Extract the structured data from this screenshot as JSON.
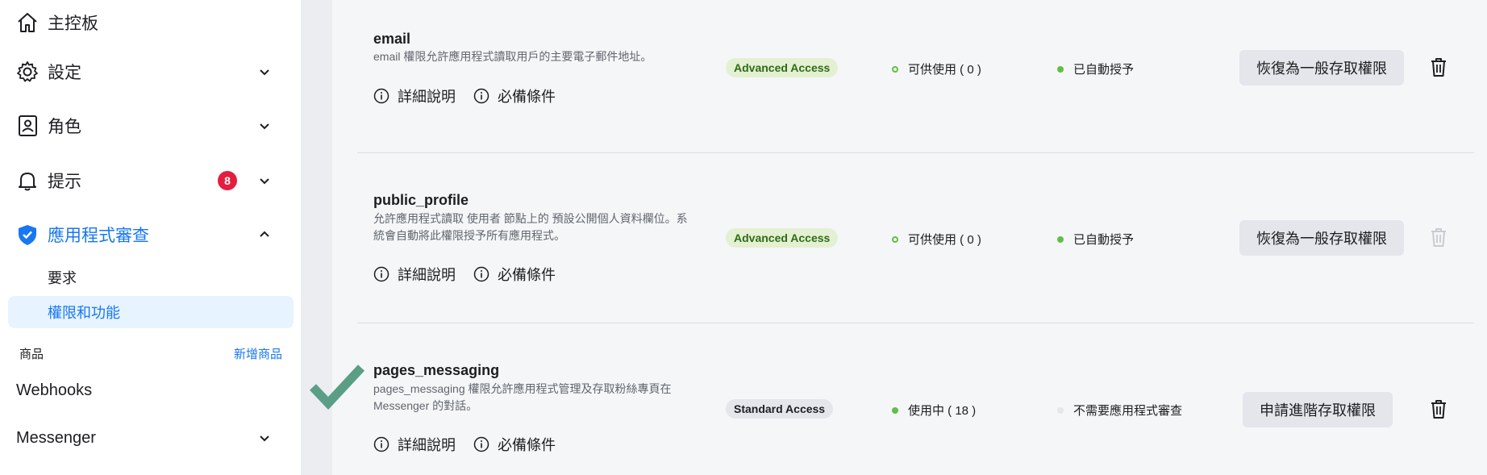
{
  "sidebar": {
    "items": [
      {
        "label": "主控板",
        "icon": "home-icon"
      },
      {
        "label": "設定",
        "icon": "gear-icon"
      },
      {
        "label": "角色",
        "icon": "person-id-icon"
      },
      {
        "label": "提示",
        "icon": "bell-icon",
        "badge": "8"
      },
      {
        "label": "應用程式審查",
        "icon": "shield-check-icon"
      }
    ],
    "sub_items": [
      {
        "label": "要求"
      },
      {
        "label": "權限和功能"
      }
    ],
    "products_header": "商品",
    "add_product_link": "新增商品",
    "products": [
      {
        "label": "Webhooks"
      },
      {
        "label": "Messenger"
      }
    ]
  },
  "permissions": [
    {
      "name": "email",
      "description": "email 權限允許應用程式讀取用戶的主要電子郵件地址。",
      "details_label": "詳細說明",
      "requirements_label": "必備條件",
      "access_level": "Advanced Access",
      "usage_status": "可供使用 ( 0 )",
      "review_status": "已自動授予",
      "action_label": "恢復為一般存取權限",
      "trash_enabled": true
    },
    {
      "name": "public_profile",
      "description": "允許應用程式讀取 使用者 節點上的 預設公開個人資料欄位。系統會自動將此權限授予所有應用程式。",
      "details_label": "詳細說明",
      "requirements_label": "必備條件",
      "access_level": "Advanced Access",
      "usage_status": "可供使用 ( 0 )",
      "review_status": "已自動授予",
      "action_label": "恢復為一般存取權限",
      "trash_enabled": false
    },
    {
      "name": "pages_messaging",
      "description": "pages_messaging 權限允許應用程式管理及存取粉絲專頁在 Messenger 的對話。",
      "details_label": "詳細說明",
      "requirements_label": "必備條件",
      "access_level": "Standard Access",
      "usage_status": "使用中 ( 18 )",
      "review_status": "不需要應用程式審查",
      "action_label": "申請進階存取權限",
      "trash_enabled": true
    }
  ],
  "colors": {
    "accent": "#1877f2",
    "green": "#63be44",
    "check": "#5a9e86",
    "badge_red": "#e41e3f"
  }
}
